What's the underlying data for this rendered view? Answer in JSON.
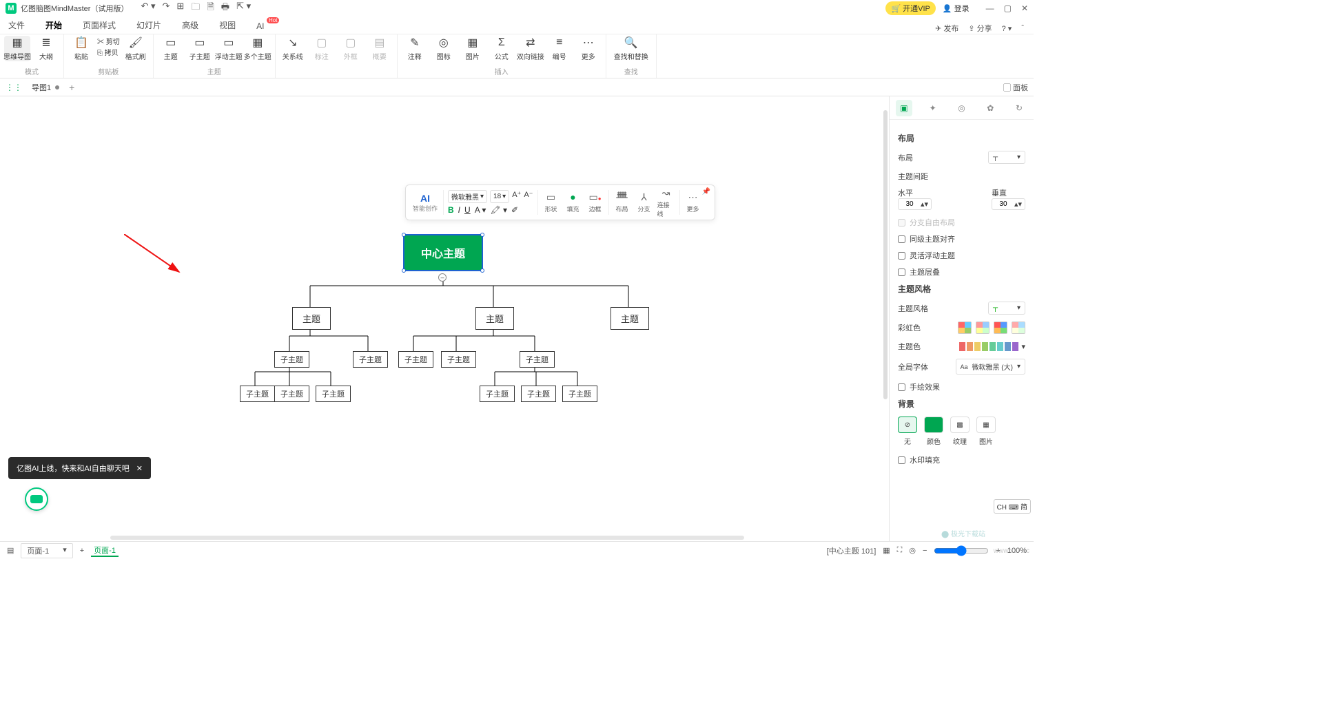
{
  "title": "亿图脑图MindMaster（试用版）",
  "vip": "开通VIP",
  "login": "登录",
  "menus": [
    "文件",
    "开始",
    "页面样式",
    "幻灯片",
    "高级",
    "视图",
    "AI"
  ],
  "menu_active": 1,
  "menubar_right": {
    "publish": "发布",
    "share": "分享"
  },
  "ribbon": {
    "mode": {
      "label": "模式",
      "items": [
        {
          "l": "思维导图",
          "i": "▦"
        },
        {
          "l": "大纲",
          "i": "≣"
        }
      ]
    },
    "clip": {
      "label": "剪贴板",
      "paste": "粘贴",
      "cut": "剪切",
      "copy": "拷贝",
      "fmt": "格式刷"
    },
    "topic": {
      "label": "主题",
      "items": [
        {
          "l": "主题",
          "i": "▭"
        },
        {
          "l": "子主题",
          "i": "▭"
        },
        {
          "l": "浮动主题",
          "i": "▭"
        },
        {
          "l": "多个主题",
          "i": "▭"
        }
      ]
    },
    "rel": {
      "l": "关系线",
      "i": "↘"
    },
    "mark": {
      "l": "标注",
      "i": "▢",
      "dis": true
    },
    "frame": {
      "l": "外框",
      "i": "▢",
      "dis": true
    },
    "summary": {
      "l": "概要",
      "i": "▤",
      "dis": true
    },
    "insert": {
      "label": "插入",
      "items": [
        {
          "l": "注释",
          "i": "✎"
        },
        {
          "l": "图标",
          "i": "◎"
        },
        {
          "l": "图片",
          "i": "▦"
        },
        {
          "l": "公式",
          "i": "Σ"
        },
        {
          "l": "双向链接",
          "i": "⇄"
        },
        {
          "l": "编号",
          "i": "≡"
        },
        {
          "l": "更多",
          "i": "⋯"
        }
      ]
    },
    "find": {
      "label": "查找",
      "l": "查找和替换",
      "i": "🔍"
    }
  },
  "doctab": "导图1",
  "panel_label": "面板",
  "ftool": {
    "ai": "AI",
    "ai_sub": "智能创作",
    "font": "微软雅黑",
    "size": "18",
    "shape": "形状",
    "fill": "填充",
    "border": "边框",
    "layout": "布局",
    "branch": "分支",
    "conn": "连接线",
    "more": "更多"
  },
  "mindmap": {
    "central": "中心主题",
    "topics": [
      "主题",
      "主题",
      "主题"
    ],
    "sub": "子主题"
  },
  "rpanel": {
    "layout_h": "布局",
    "layout": "布局",
    "spacing": "主题间距",
    "h": "水平",
    "v": "垂直",
    "hv": "30",
    "vv": "30",
    "c1": "分支自由布局",
    "c2": "同级主题对齐",
    "c3": "灵活浮动主题",
    "c4": "主题层叠",
    "style_h": "主题风格",
    "style": "主题风格",
    "rainbow": "彩虹色",
    "themecol": "主题色",
    "font": "全局字体",
    "fontval": "微软雅黑 (大)",
    "hand": "手绘效果",
    "bg_h": "背景",
    "bg": [
      "无",
      "颜色",
      "纹理",
      "图片"
    ],
    "wm": "水印填充"
  },
  "ime": "CH ⌨ 简",
  "status": {
    "page": "页面-1",
    "pagetab": "页面-1",
    "sel": "[中心主题 101]",
    "zoom": "100%"
  },
  "toast": "亿图AI上线，快来和AI自由聊天吧",
  "watermark": "极光下载站",
  "watermark2": "www.xz7.cc"
}
